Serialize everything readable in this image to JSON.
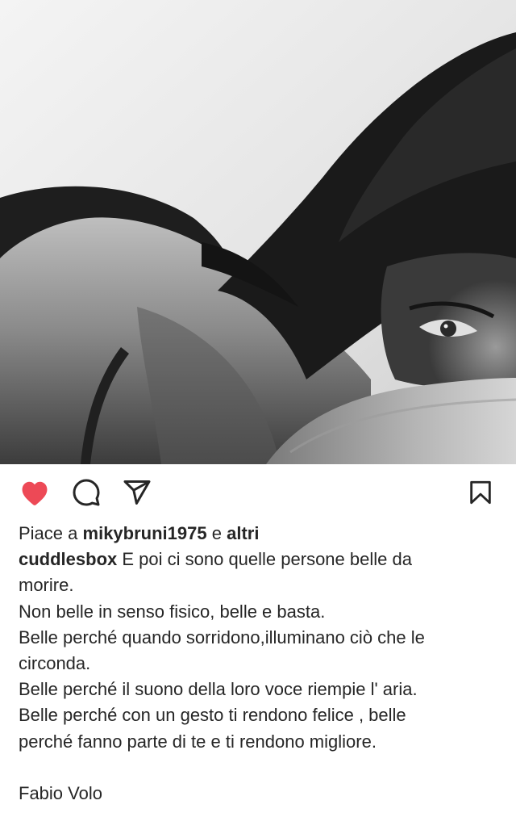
{
  "post": {
    "image_alt": "Black and white photo of a woman lying face down, eye visible through her hair",
    "actions": {
      "like": {
        "icon": "heart-icon",
        "liked": true,
        "color": "#ed4956"
      },
      "comment": {
        "icon": "comment-icon"
      },
      "share": {
        "icon": "send-icon"
      },
      "save": {
        "icon": "bookmark-icon"
      }
    },
    "likes": {
      "prefix": "Piace a",
      "first_liker": "mikybruni1975",
      "connector": "e",
      "others": "altri"
    },
    "caption": {
      "username": "cuddlesbox",
      "first_line": "E poi ci sono quelle persone belle da",
      "lines": [
        "morire.",
        "Non belle in senso fisico, belle e basta.",
        "Belle perché quando sorridono,illuminano ciò che le",
        "circonda.",
        "Belle perché il suono della loro voce riempie l' aria.",
        "Belle perché con un gesto ti rendono felice , belle",
        "perché fanno parte di te e ti rendono migliore."
      ],
      "signature": "Fabio Volo"
    }
  }
}
